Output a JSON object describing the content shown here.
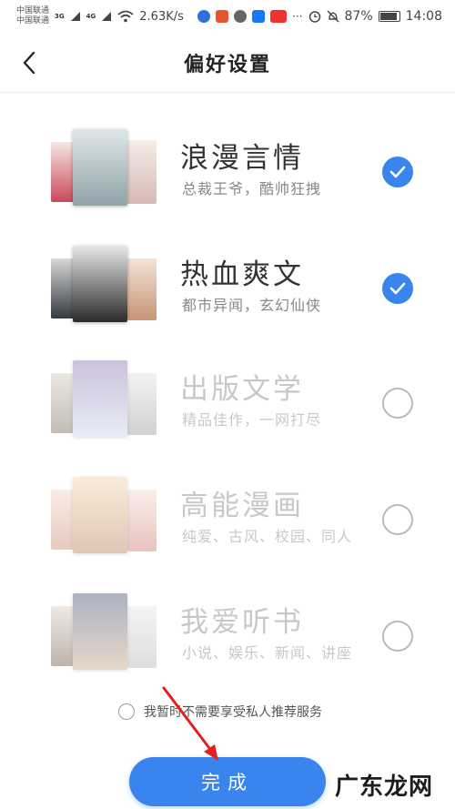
{
  "status_bar": {
    "carrier1": "中国联通",
    "carrier2": "中国联通",
    "net1": "3G",
    "net2": "4G",
    "speed": "2.63K/s",
    "battery": "87%",
    "time": "14:08"
  },
  "header": {
    "title": "偏好设置"
  },
  "preferences": [
    {
      "name": "浪漫言情",
      "desc": "总裁王爷，酷帅狂拽",
      "checked": true
    },
    {
      "name": "热血爽文",
      "desc": "都市异闻，玄幻仙侠",
      "checked": true
    },
    {
      "name": "出版文学",
      "desc": "精品佳作，一网打尽",
      "checked": false
    },
    {
      "name": "高能漫画",
      "desc": "纯爱、古风、校园、同人",
      "checked": false
    },
    {
      "name": "我爱听书",
      "desc": "小说、娱乐、新闻、讲座",
      "checked": false
    }
  ],
  "privacy_text": "我暂时不需要享受私人推荐服务",
  "done_label": "完成",
  "watermark": "广东龙网",
  "colors": {
    "accent": "#3a84ee",
    "annotation_arrow": "#e02020"
  }
}
